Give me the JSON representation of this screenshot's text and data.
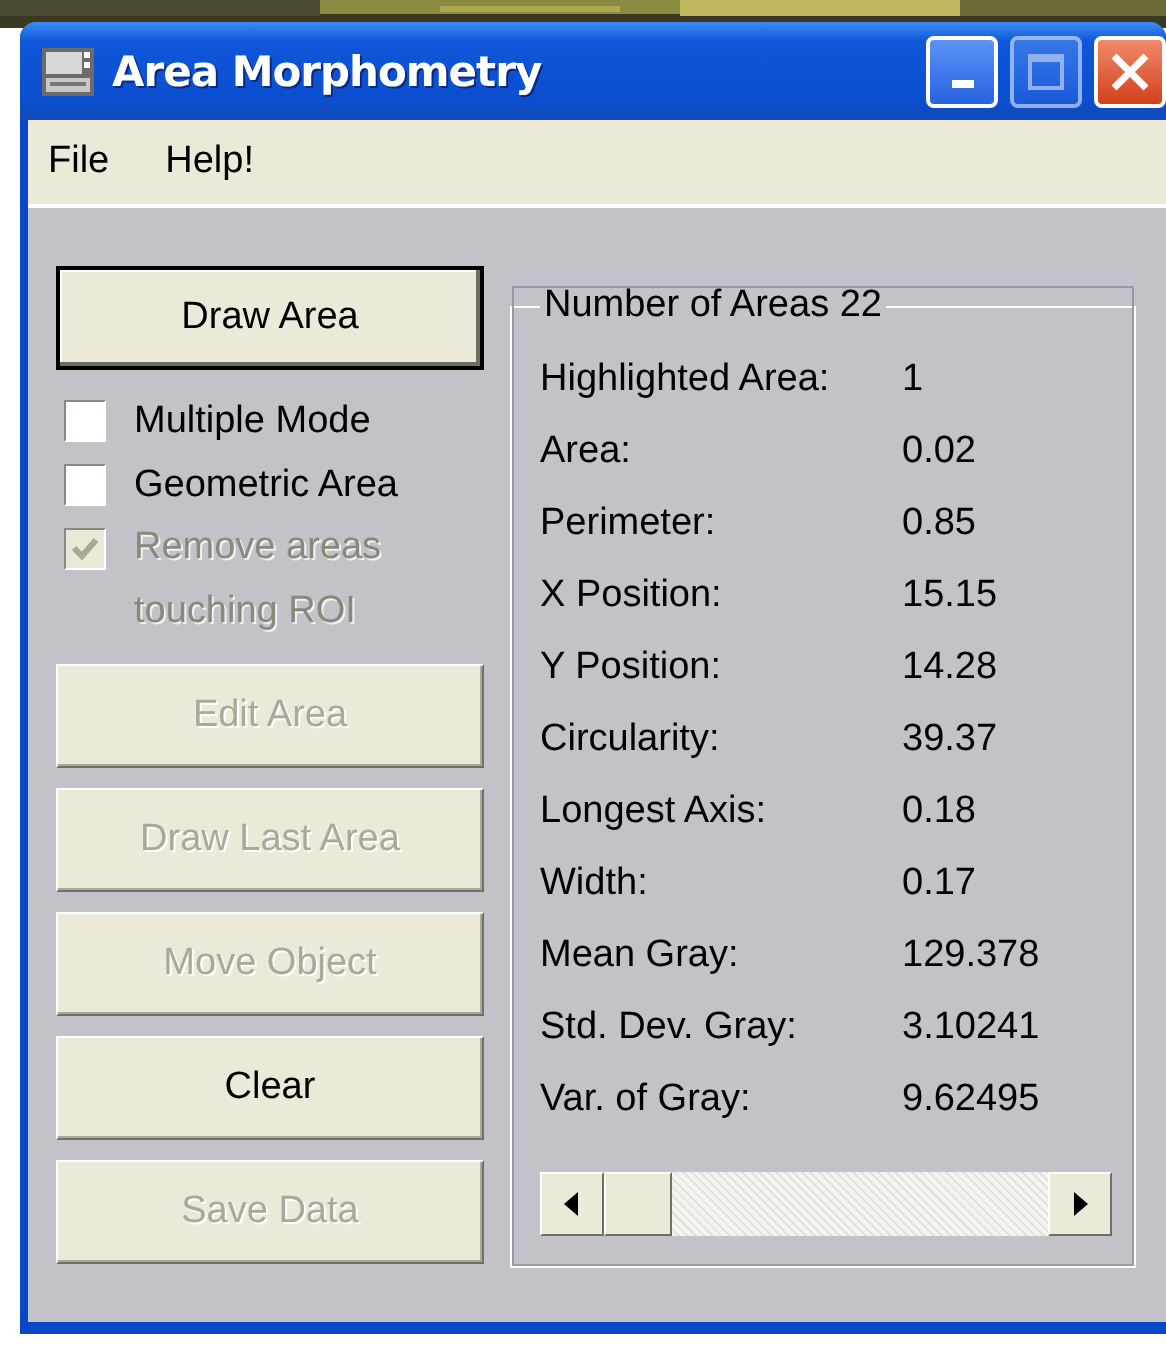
{
  "window": {
    "title": "Area Morphometry"
  },
  "menu": [
    {
      "label": "File"
    },
    {
      "label": "Help!"
    }
  ],
  "controls": [
    {
      "kind": "button",
      "label": "Draw Area",
      "disabled": false,
      "focused": true
    },
    {
      "kind": "checkbox",
      "label": "Multiple Mode",
      "checked": false,
      "disabled": false
    },
    {
      "kind": "checkbox",
      "label": "Geometric Area",
      "checked": false,
      "disabled": false
    },
    {
      "kind": "checkbox",
      "label": "Remove areas touching ROI",
      "checked": true,
      "disabled": true
    },
    {
      "kind": "button",
      "label": "Edit Area",
      "disabled": true,
      "focused": false
    },
    {
      "kind": "button",
      "label": "Draw Last Area",
      "disabled": true,
      "focused": false
    },
    {
      "kind": "button",
      "label": "Move Object",
      "disabled": true,
      "focused": false
    },
    {
      "kind": "button",
      "label": "Clear",
      "disabled": false,
      "focused": false
    },
    {
      "kind": "button",
      "label": "Save Data",
      "disabled": true,
      "focused": false
    }
  ],
  "results": {
    "title": "Number of Areas 22",
    "rows": [
      {
        "label": "Highlighted Area:",
        "value": "1"
      },
      {
        "label": "Area:",
        "value": "0.02"
      },
      {
        "label": "Perimeter:",
        "value": "0.85"
      },
      {
        "label": "X Position:",
        "value": "15.15"
      },
      {
        "label": "Y Position:",
        "value": "14.28"
      },
      {
        "label": "Circularity:",
        "value": "39.37"
      },
      {
        "label": "Longest Axis:",
        "value": "0.18"
      },
      {
        "label": "Width:",
        "value": "0.17"
      },
      {
        "label": "Mean Gray:",
        "value": "129.378"
      },
      {
        "label": "Std. Dev. Gray:",
        "value": "3.10241"
      },
      {
        "label": "Var. of Gray:",
        "value": "9.62495"
      }
    ]
  }
}
